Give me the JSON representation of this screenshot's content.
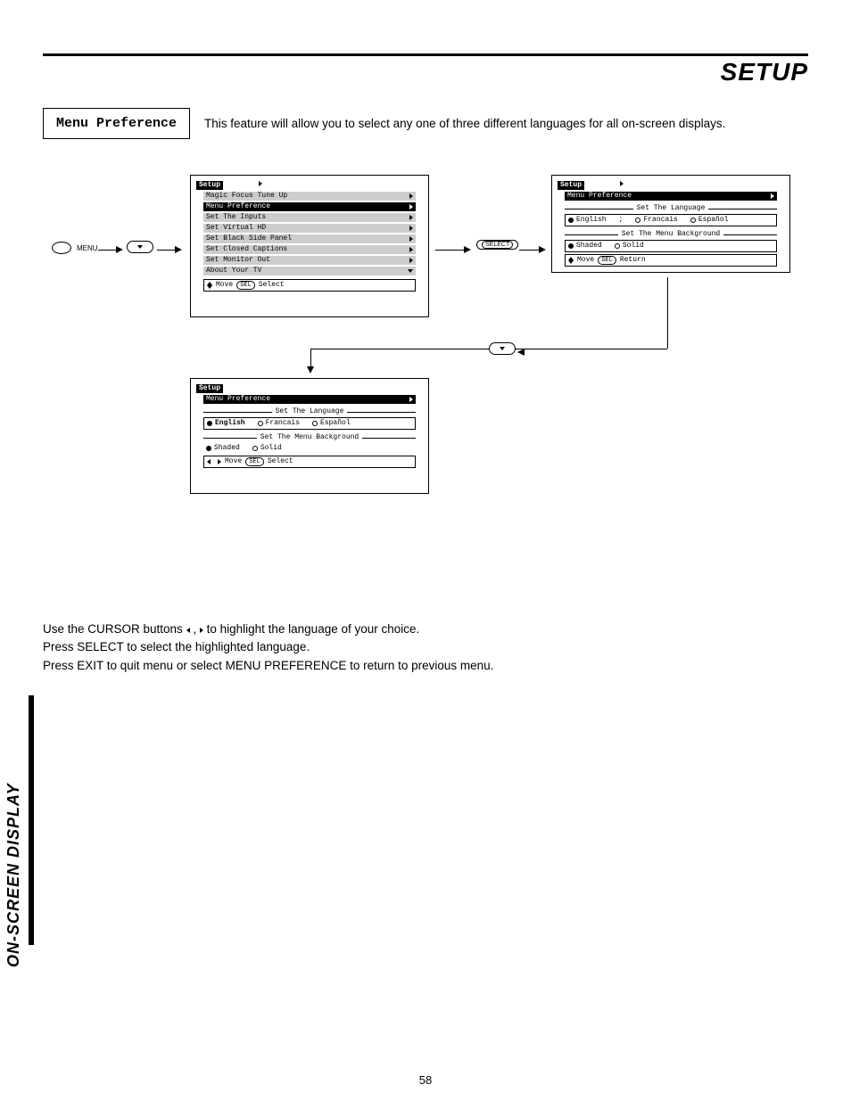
{
  "header": {
    "title": "SETUP"
  },
  "feature": {
    "label": "Menu Preference",
    "description": "This feature will allow you to select any one of three different languages for all on-screen displays."
  },
  "screen1": {
    "title": "Setup",
    "items": [
      "Magic Focus Tune Up",
      "Menu Preference",
      "Set The Inputs",
      "Set Virtual HD",
      "Set Black Side Panel",
      "Set Closed Captions",
      "Set Monitor Out",
      "About Your TV"
    ],
    "selected_index": 1,
    "hint_move": "Move",
    "hint_sel_pill": "SEL",
    "hint_select": "Select"
  },
  "screen2": {
    "title": "Setup",
    "subtitle": "Menu Preference",
    "group1_label": "Set The Language",
    "langs": [
      "English",
      "Francais",
      "Español"
    ],
    "lang_selected": 0,
    "group2_label": "Set The Menu Background",
    "bgs": [
      "Shaded",
      "Solid"
    ],
    "bg_selected": 0,
    "hint_move": "Move",
    "hint_sel_pill": "SEL",
    "hint_return": "Return"
  },
  "screen3": {
    "title": "Setup",
    "subtitle": "Menu Preference",
    "group1_label": "Set The Language",
    "langs": [
      "English",
      "Francais",
      "Español"
    ],
    "lang_selected": 0,
    "group2_label": "Set The Menu Background",
    "bgs": [
      "Shaded",
      "Solid"
    ],
    "bg_selected": 0,
    "hint_move": "Move",
    "hint_sel_pill": "SEL",
    "hint_select": "Select"
  },
  "remote": {
    "menu_label": "MENU",
    "select_label": "SELECT"
  },
  "instructions": {
    "line1_a": "Use the CURSOR buttons ",
    "line1_b": " , ",
    "line1_c": " to highlight the language of your choice.",
    "line2": "Press SELECT to select the highlighted language.",
    "line3": "Press EXIT to quit menu or select MENU PREFERENCE to return to previous menu."
  },
  "side_tab": "ON-SCREEN DISPLAY",
  "page_number": "58"
}
